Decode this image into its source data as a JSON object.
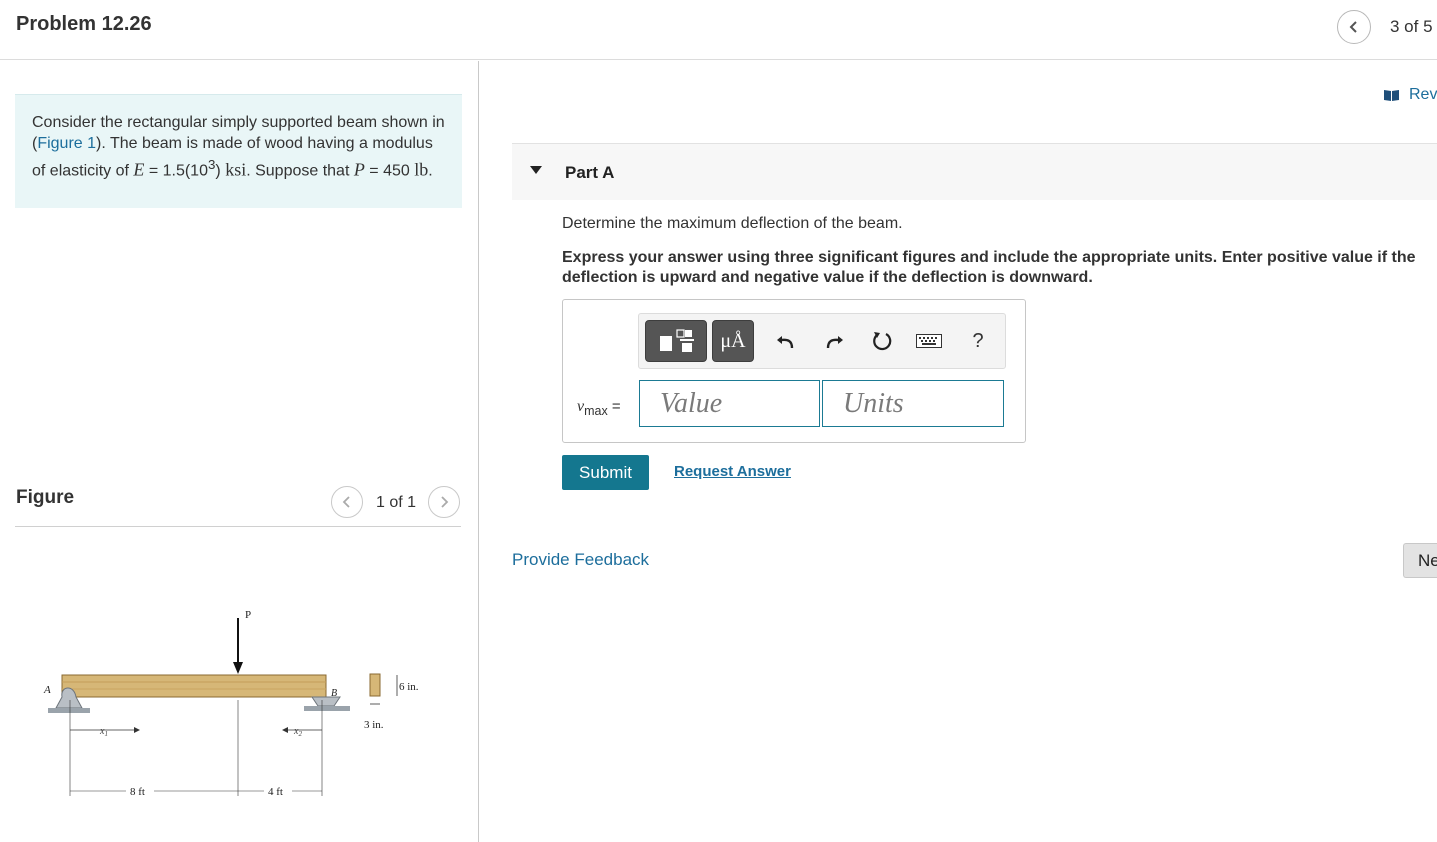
{
  "header": {
    "title": "Problem 12.26",
    "nav_count": "3 of 5"
  },
  "problem": {
    "text_1": "Consider the rectangular simply supported beam shown in (",
    "figure_link": "Figure 1",
    "text_2": "). The beam is made of wood having a modulus of elasticity of ",
    "E_symbol": "E",
    "E_value": " = 1.5(10",
    "E_exp": "3",
    "E_close": ") ",
    "E_unit": "ksi",
    "text_3": ". Suppose that ",
    "P_symbol": "P",
    "P_value": " = 450 ",
    "P_unit": "lb",
    "text_4": "."
  },
  "figure": {
    "heading": "Figure",
    "count": "1 of 1",
    "labels": {
      "P": "P",
      "A": "A",
      "B": "B",
      "x1": "x",
      "x1_sub": "1",
      "x2": "x",
      "x2_sub": "2",
      "height": "6 in.",
      "width": "3 in.",
      "span1": "8 ft",
      "span2": "4 ft"
    }
  },
  "review": {
    "label": "Rev"
  },
  "part": {
    "title": "Part A",
    "question": "Determine the maximum deflection of the beam.",
    "instructions": "Express your answer using three significant figures and include the appropriate units. Enter positive value if the deflection is upward and negative value if the deflection is downward."
  },
  "answer": {
    "var": "v",
    "var_sub": "max",
    "equals": " =",
    "value_placeholder": "Value",
    "units_placeholder": "Units",
    "units_button": "μÅ",
    "help_button": "?"
  },
  "actions": {
    "submit": "Submit",
    "request_answer": "Request Answer",
    "provide_feedback": "Provide Feedback",
    "next": "Next"
  },
  "colors": {
    "accent": "#14778f",
    "link": "#1d6e9c",
    "problem_bg": "#e9f6f7",
    "beam_wood": "#d6b777"
  },
  "icons": [
    "chevron-left-icon",
    "chevron-right-icon",
    "book-icon",
    "triangle-down-icon",
    "templates-icon",
    "undo-icon",
    "redo-icon",
    "reset-icon",
    "keyboard-icon"
  ]
}
